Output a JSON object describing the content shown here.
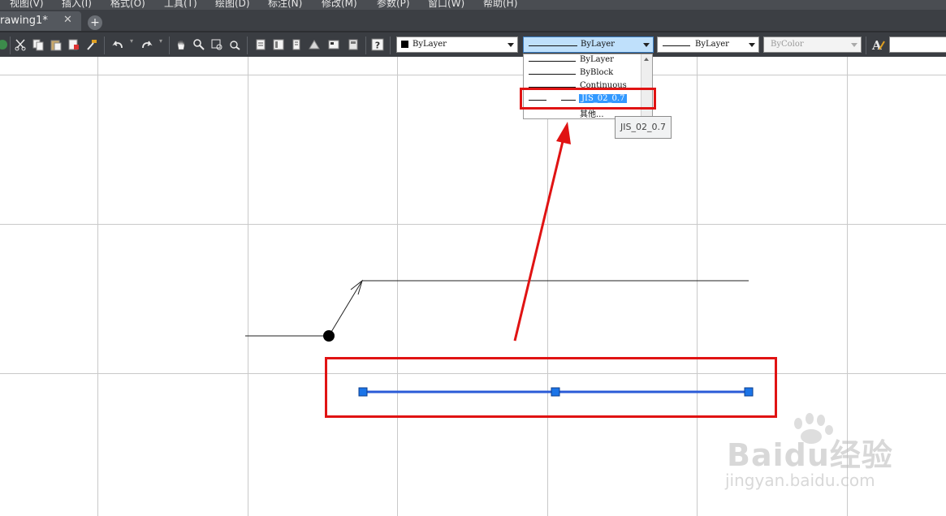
{
  "menubar": {
    "items": [
      "视图(V)",
      "插入(I)",
      "格式(O)",
      "工具(T)",
      "绘图(D)",
      "标注(N)",
      "修改(M)",
      "参数(P)",
      "窗口(W)",
      "帮助(H)"
    ]
  },
  "tabs": {
    "active_label": "rawing1*",
    "close_glyph": "✕",
    "add_glyph": "+"
  },
  "toolbar": {
    "color_combo": "ByLayer",
    "linetype_combo": "ByLayer",
    "lineweight_combo": "ByLayer",
    "plotstyle_combo": "ByColor"
  },
  "linetype_dropdown": {
    "options": [
      "ByLayer",
      "ByBlock",
      "Continuous",
      "JIS_02_0.7",
      "其他..."
    ],
    "selected_index": 3
  },
  "tooltip": "JIS_02_0.7",
  "watermark": {
    "brand": "Baidu经验",
    "site": "jingyan.baidu.com"
  },
  "colors": {
    "annotation_red": "#e01313",
    "selection_blue": "#2a5bd7",
    "grip_blue": "#1b74e8",
    "highlight_blue": "#3399ff"
  }
}
